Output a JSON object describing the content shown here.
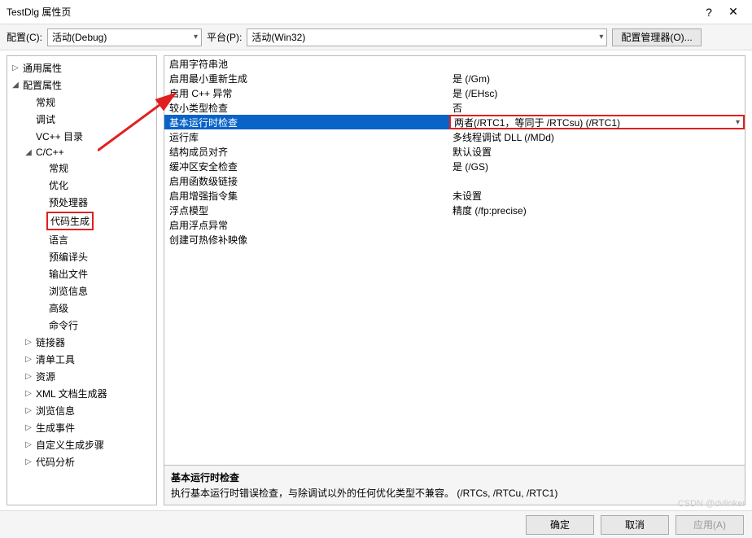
{
  "window": {
    "title": "TestDlg 属性页"
  },
  "toolbar": {
    "config_label": "配置(C):",
    "config_value": "活动(Debug)",
    "platform_label": "平台(P):",
    "platform_value": "活动(Win32)",
    "cfgmgr_label": "配置管理器(O)..."
  },
  "tree": [
    {
      "label": "通用属性",
      "depth": 0,
      "tw": "▷"
    },
    {
      "label": "配置属性",
      "depth": 0,
      "tw": "◢"
    },
    {
      "label": "常规",
      "depth": 1,
      "tw": ""
    },
    {
      "label": "调试",
      "depth": 1,
      "tw": ""
    },
    {
      "label": "VC++ 目录",
      "depth": 1,
      "tw": ""
    },
    {
      "label": "C/C++",
      "depth": 1,
      "tw": "◢"
    },
    {
      "label": "常规",
      "depth": 2,
      "tw": ""
    },
    {
      "label": "优化",
      "depth": 2,
      "tw": ""
    },
    {
      "label": "预处理器",
      "depth": 2,
      "tw": ""
    },
    {
      "label": "代码生成",
      "depth": 2,
      "tw": "",
      "red": true
    },
    {
      "label": "语言",
      "depth": 2,
      "tw": ""
    },
    {
      "label": "预编译头",
      "depth": 2,
      "tw": ""
    },
    {
      "label": "输出文件",
      "depth": 2,
      "tw": ""
    },
    {
      "label": "浏览信息",
      "depth": 2,
      "tw": ""
    },
    {
      "label": "高级",
      "depth": 2,
      "tw": ""
    },
    {
      "label": "命令行",
      "depth": 2,
      "tw": ""
    },
    {
      "label": "链接器",
      "depth": 1,
      "tw": "▷"
    },
    {
      "label": "清单工具",
      "depth": 1,
      "tw": "▷"
    },
    {
      "label": "资源",
      "depth": 1,
      "tw": "▷"
    },
    {
      "label": "XML 文档生成器",
      "depth": 1,
      "tw": "▷"
    },
    {
      "label": "浏览信息",
      "depth": 1,
      "tw": "▷"
    },
    {
      "label": "生成事件",
      "depth": 1,
      "tw": "▷"
    },
    {
      "label": "自定义生成步骤",
      "depth": 1,
      "tw": "▷"
    },
    {
      "label": "代码分析",
      "depth": 1,
      "tw": "▷"
    }
  ],
  "grid": [
    {
      "k": "启用字符串池",
      "v": ""
    },
    {
      "k": "启用最小重新生成",
      "v": "是 (/Gm)"
    },
    {
      "k": "启用 C++ 异常",
      "v": "是 (/EHsc)"
    },
    {
      "k": "较小类型检查",
      "v": "否"
    },
    {
      "k": "基本运行时检查",
      "v": "两者(/RTC1，等同于 /RTCsu) (/RTC1)",
      "sel": true
    },
    {
      "k": "运行库",
      "v": "多线程调试 DLL (/MDd)"
    },
    {
      "k": "结构成员对齐",
      "v": "默认设置"
    },
    {
      "k": "缓冲区安全检查",
      "v": "是 (/GS)"
    },
    {
      "k": "启用函数级链接",
      "v": ""
    },
    {
      "k": "启用增强指令集",
      "v": "未设置"
    },
    {
      "k": "浮点模型",
      "v": "精度 (/fp:precise)"
    },
    {
      "k": "启用浮点异常",
      "v": ""
    },
    {
      "k": "创建可热修补映像",
      "v": ""
    }
  ],
  "desc": {
    "title": "基本运行时检查",
    "text": "执行基本运行时错误检查，与除调试以外的任何优化类型不兼容。     (/RTCs, /RTCu, /RTC1)"
  },
  "footer": {
    "ok": "确定",
    "cancel": "取消",
    "apply": "应用(A)"
  },
  "watermark": "CSDN @dvlinker"
}
